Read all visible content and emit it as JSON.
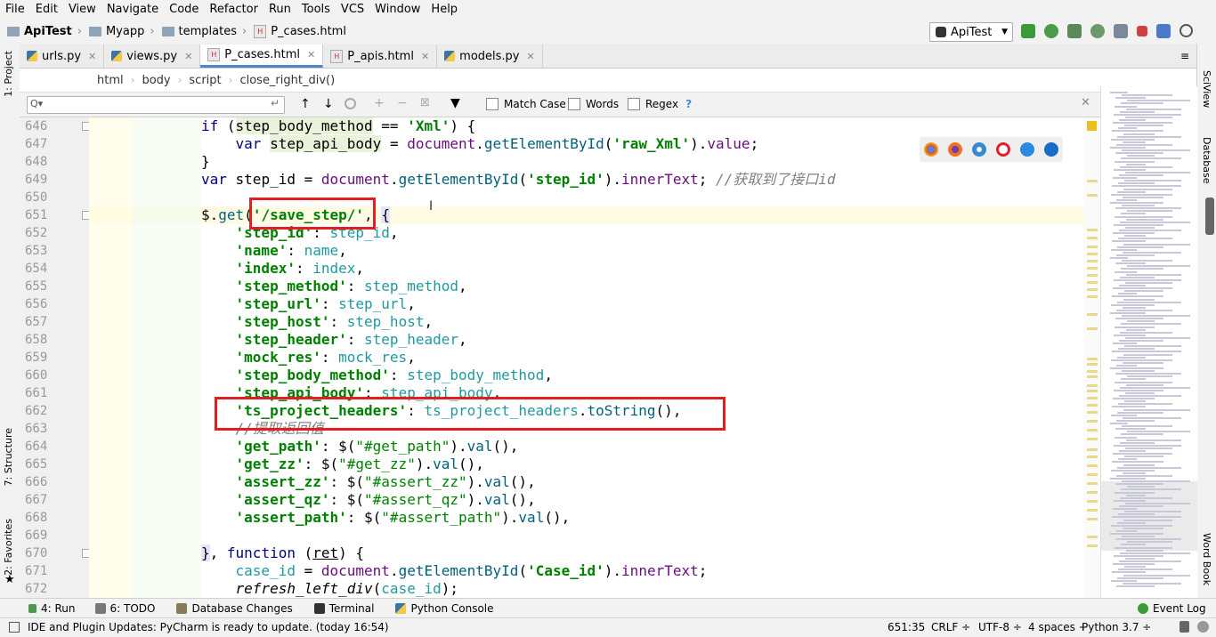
{
  "menu": [
    "File",
    "Edit",
    "View",
    "Navigate",
    "Code",
    "Refactor",
    "Run",
    "Tools",
    "VCS",
    "Window",
    "Help"
  ],
  "nav": {
    "project": "ApiTest",
    "folder1": "Myapp",
    "folder2": "templates",
    "file": "P_cases.html"
  },
  "run_config": "ApiTest",
  "left_tabs": {
    "project": "1: Project",
    "structure": "7: Structure",
    "favorites": "2: Favorites"
  },
  "right_tabs": {
    "sciview": "SciView",
    "database": "Database",
    "wordbook": "Word Book"
  },
  "tabs": [
    {
      "label": "urls.py",
      "icon": "python-icon"
    },
    {
      "label": "views.py",
      "icon": "python-icon"
    },
    {
      "label": "P_cases.html",
      "icon": "html-icon",
      "active": true
    },
    {
      "label": "P_apis.html",
      "icon": "html-icon"
    },
    {
      "label": "models.py",
      "icon": "python-icon"
    }
  ],
  "breadcrumb": [
    "html",
    "body",
    "script",
    "close_right_div()"
  ],
  "search": {
    "placeholder": "Q▾",
    "match_case": "Match Case",
    "words": "Words",
    "regex": "Regex",
    "help": "?"
  },
  "lines": [
    "646",
    "647",
    "648",
    "649",
    "650",
    "651",
    "652",
    "653",
    "654",
    "655",
    "656",
    "657",
    "658",
    "659",
    "660",
    "661",
    "662",
    "663",
    "664",
    "665",
    "666",
    "667",
    "668",
    "669",
    "670",
    "671",
    "672"
  ],
  "bottom_tools": {
    "run": "4: Run",
    "todo": "6: TODO",
    "db_changes": "Database Changes",
    "terminal": "Terminal",
    "python_console": "Python Console",
    "event_log": "Event Log"
  },
  "status": {
    "message": "IDE and Plugin Updates: PyCharm is ready to update. (today 16:54)",
    "position": "651:35",
    "line_sep": "CRLF ÷",
    "encoding": "UTF-8 ÷",
    "indent": "4 spaces ÷",
    "interpreter": "Python 3.7 ÷"
  },
  "colors": {
    "accent": "#4a88c7",
    "highlight_box": "#e02020",
    "string": "#008000",
    "keyword": "#000080"
  }
}
